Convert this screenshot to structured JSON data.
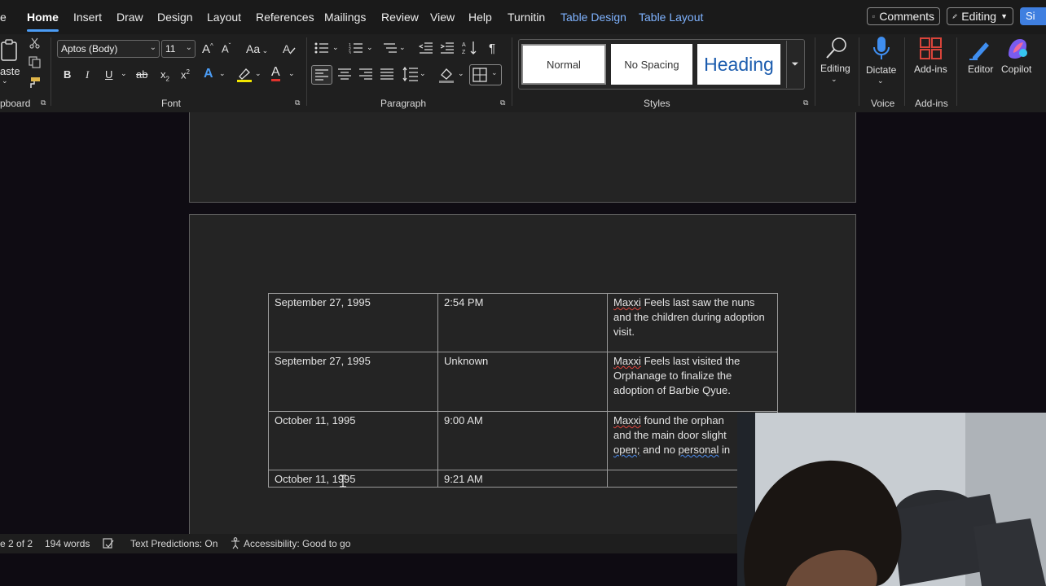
{
  "menu": {
    "file_partial": "e",
    "tabs": [
      "Home",
      "Insert",
      "Draw",
      "Design",
      "Layout",
      "References",
      "Mailings",
      "Review",
      "View",
      "Help",
      "Turnitin"
    ],
    "context_tabs": [
      "Table Design",
      "Table Layout"
    ],
    "comments_label": "Comments",
    "editing_mode_label": "Editing",
    "share_partial": "Si"
  },
  "ribbon": {
    "clipboard": {
      "paste_partial": "aste",
      "group_label": "pboard"
    },
    "font": {
      "family": "Aptos (Body)",
      "size": "11",
      "case_label": "Aa",
      "group_label": "Font",
      "bold": "B",
      "italic": "I",
      "underline": "U",
      "strike": "ab",
      "subscript": "x",
      "superscript": "x",
      "text_effects": "A",
      "font_color": "A"
    },
    "paragraph": {
      "group_label": "Paragraph",
      "pilcrow": "¶"
    },
    "styles": {
      "normal": "Normal",
      "no_spacing": "No Spacing",
      "heading": "Heading",
      "group_label": "Styles"
    },
    "editing": {
      "label": "Editing"
    },
    "voice": {
      "dictate_label": "Dictate",
      "group_label": "Voice"
    },
    "addins": {
      "label": "Add-ins",
      "group_label": "Add-ins"
    },
    "editor_label": "Editor",
    "copilot_label": "Copilot"
  },
  "table": {
    "rows": [
      {
        "date": "September 27, 1995",
        "time": "2:54 PM",
        "event": {
          "name": "Maxxi",
          "text": " Feels last saw the nuns and the children during adoption visit."
        }
      },
      {
        "date": "September 27, 1995",
        "time": "Unknown",
        "event": {
          "name": "Maxxi",
          "text": " Feels last visited the Orphanage to finalize the adoption of Barbie Qyue."
        }
      },
      {
        "date": "October 11, 1995",
        "time": "9:00 AM",
        "event": {
          "name": "Maxxi",
          "text_a": " found the orphan",
          "text_b": "and the main door slight",
          "text_c": "open;",
          "text_d": " and no ",
          "text_e": "personal",
          "text_f": " in"
        }
      },
      {
        "date": "October 11, 1995",
        "time": "9:21 AM",
        "event": {}
      }
    ]
  },
  "status": {
    "page_info": "e 2 of 2",
    "words": "194 words",
    "text_predictions": "Text Predictions: On",
    "accessibility": "Accessibility: Good to go"
  },
  "colors": {
    "accent": "#4b9cf5",
    "context_tab": "#7fb3ff",
    "spelling": "#e0453d",
    "grammar": "#4c8cf0"
  }
}
